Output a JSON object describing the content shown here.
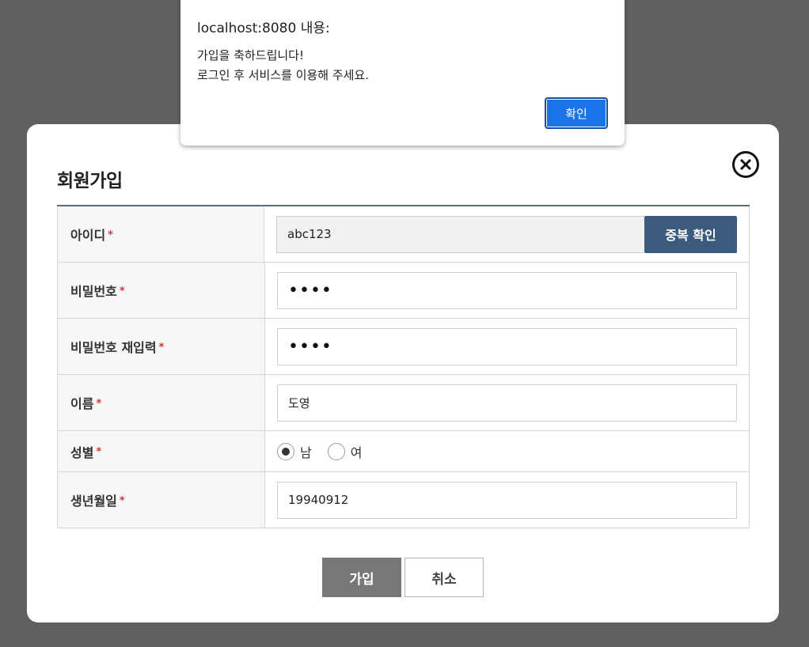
{
  "alert": {
    "title": "localhost:8080 내용:",
    "line1": "가입을 축하드립니다!",
    "line2": "로그인 후 서비스를 이용해 주세요.",
    "ok_label": "확인",
    "ok_color": "#1a73e8"
  },
  "modal": {
    "title": "회원가입",
    "close_icon": "close-circle-icon",
    "required_mark": "*",
    "fields": {
      "id": {
        "label": "아이디",
        "value": "abc123",
        "check_button": "중복 확인"
      },
      "password": {
        "label": "비밀번호",
        "value": "••••"
      },
      "password_confirm": {
        "label": "비밀번호 재입력",
        "value": "••••"
      },
      "name": {
        "label": "이름",
        "value": "도영"
      },
      "gender": {
        "label": "성별",
        "options": [
          "남",
          "여"
        ],
        "selected": "남"
      },
      "birth": {
        "label": "생년월일",
        "value": "19940912"
      }
    },
    "join_label": "가입",
    "cancel_label": "취소"
  },
  "colors": {
    "backdrop": "#5f6062",
    "header_border": "#5c6b7a",
    "dup_button": "#3b5a7c",
    "join_button": "#777777",
    "required": "#d03a3a"
  }
}
